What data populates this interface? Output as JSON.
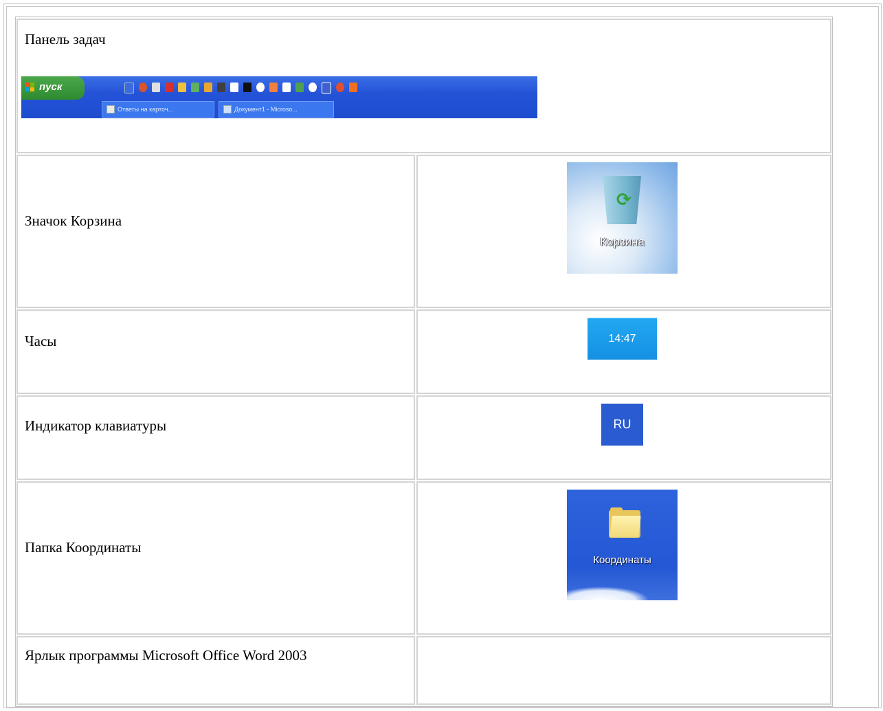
{
  "rows": [
    {
      "label": "Панель задач"
    },
    {
      "label": "Значок Корзина"
    },
    {
      "label": "Часы"
    },
    {
      "label": "Индикатор клавиатуры"
    },
    {
      "label": "Папка Координаты"
    },
    {
      "label": "Ярлык программы Microsoft Office Word 2003"
    }
  ],
  "taskbar": {
    "start_label": "пуск",
    "buttons": [
      "Ответы на карточ...",
      "Документ1 - Microso..."
    ]
  },
  "recycle_bin": {
    "caption": "Корзина"
  },
  "clock": {
    "time": "14:47"
  },
  "keyboard_indicator": {
    "lang": "RU"
  },
  "folder": {
    "caption": "Координаты"
  },
  "colors": {
    "taskbar_blue": "#2553d8",
    "start_green": "#3a9a3a",
    "clock_blue": "#1a9bea",
    "folder_yellow": "#f2d978",
    "border_gray": "#d4d4d4"
  }
}
